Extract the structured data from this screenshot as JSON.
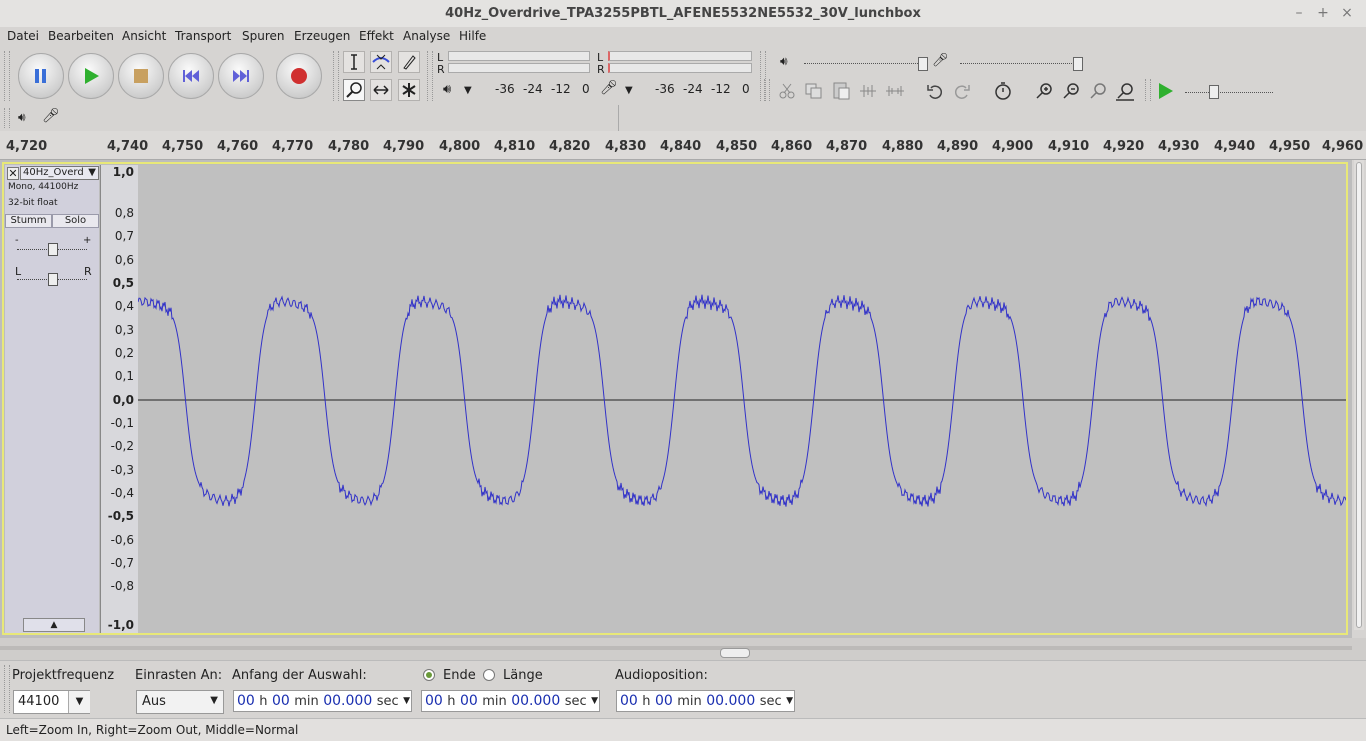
{
  "window": {
    "title": "40Hz_Overdrive_TPA3255PBTL_AFENE5532NE5532_30V_lunchbox",
    "min": "–",
    "max": "+",
    "close": "×"
  },
  "menu": [
    "Datei",
    "Bearbeiten",
    "Ansicht",
    "Transport",
    "Spuren",
    "Erzeugen",
    "Effekt",
    "Analyse",
    "Hilfe"
  ],
  "meters": {
    "play": {
      "L": "L",
      "R": "R",
      "scale": [
        "-36",
        "-24",
        "-12",
        "0"
      ]
    },
    "record": {
      "L": "L",
      "R": "R",
      "scale": [
        "-36",
        "-24",
        "-12",
        "0"
      ]
    }
  },
  "ruler": {
    "ticks": [
      "4,720",
      "4,740",
      "4,750",
      "4,760",
      "4,770",
      "4,780",
      "4,790",
      "4,800",
      "4,810",
      "4,820",
      "4,830",
      "4,840",
      "4,850",
      "4,860",
      "4,870",
      "4,880",
      "4,890",
      "4,900",
      "4,910",
      "4,920",
      "4,930",
      "4,940",
      "4,950",
      "4,960"
    ]
  },
  "track": {
    "name": "40Hz_Overd",
    "info1": "Mono, 44100Hz",
    "info2": "32-bit float",
    "mute": "Stumm",
    "solo": "Solo",
    "gain_minus": "-",
    "gain_plus": "+",
    "pan_left": "L",
    "pan_right": "R",
    "amplitude_labels": [
      "1,0",
      "0,8",
      "0,7",
      "0,6",
      "0,5",
      "0,4",
      "0,3",
      "0,2",
      "0,1",
      "0,0",
      "-0,1",
      "-0,2",
      "-0,3",
      "-0,4",
      "-0,5",
      "-0,6",
      "-0,7",
      "-0,8",
      "-1,0"
    ],
    "waveform": {
      "frequency_hz": 40,
      "peak_amplitude": 0.42,
      "color": "#3232c8"
    }
  },
  "selection_bar": {
    "project_rate_label": "Projektfrequenz",
    "project_rate": "44100",
    "snap_label": "Einrasten An:",
    "snap_value": "Aus",
    "start_label": "Anfang der Auswahl:",
    "end_label": "Ende",
    "length_label": "Länge",
    "audio_pos_label": "Audioposition:",
    "time": {
      "h": "00",
      "hu": "h",
      "m": "00",
      "mu": "min",
      "s": "00.000",
      "su": "sec"
    }
  },
  "status": "Left=Zoom In, Right=Zoom Out, Middle=Normal"
}
